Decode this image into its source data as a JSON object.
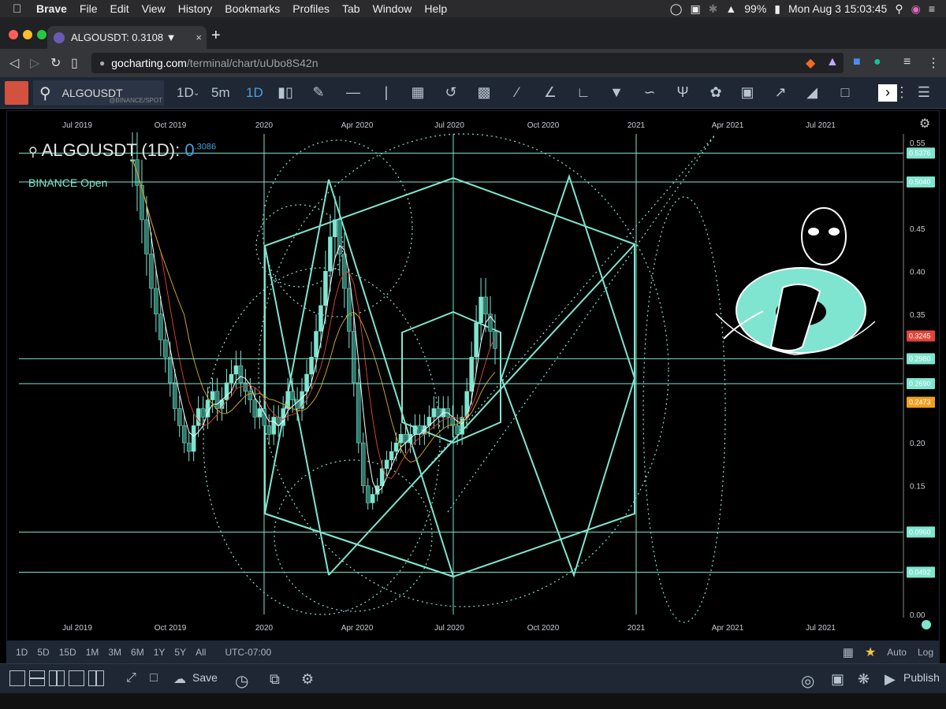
{
  "menubar": {
    "apple": "",
    "app": "Brave",
    "items": [
      "File",
      "Edit",
      "View",
      "History",
      "Bookmarks",
      "Profiles",
      "Tab",
      "Window",
      "Help"
    ],
    "battery": "99%",
    "datetime": "Mon Aug 3  15:03:45"
  },
  "browser": {
    "tab_title": "ALGOUSDT: 0.3108 ▼",
    "tab_close": "×",
    "new_tab": "+",
    "url_host": "gocharting.com",
    "url_path": "/terminal/chart/uUbo8S42n"
  },
  "toolbar": {
    "symbol": "ALGOUSDT",
    "exchange": "@BINANCE/SPOT",
    "interval_dropdown": "1D",
    "interval_5m": "5m",
    "interval_1d": "1D"
  },
  "chart": {
    "legend_symbol": "ALGOUSDT (1D):",
    "legend_value": "0",
    "legend_sup": ".3086",
    "legend_sub": "BINANCE Open",
    "accent": "#7fe5d0"
  },
  "chart_data": {
    "type": "candlestick",
    "title": "ALGOUSDT (1D)",
    "x_tick_labels": [
      "Jul 2019",
      "Oct 2019",
      "2020",
      "Apr 2020",
      "Jul 2020",
      "Oct 2020",
      "2021",
      "Apr 2021",
      "Jul 2021"
    ],
    "y_tick_labels": [
      "0.55",
      "0.45",
      "0.40",
      "0.35",
      "0.20",
      "0.15",
      "0.00"
    ],
    "ylim": [
      0,
      0.56
    ],
    "price_tags": [
      {
        "value": "0.5376",
        "color": "#7fe5d0"
      },
      {
        "value": "0.5040",
        "color": "#7fe5d0"
      },
      {
        "value": "0.3245",
        "color": "#e0463a"
      },
      {
        "value": "0.2980",
        "color": "#7fe5d0"
      },
      {
        "value": "0.2690",
        "color": "#7fe5d0"
      },
      {
        "value": "0.2473",
        "color": "#f0a020"
      },
      {
        "value": "0.0960",
        "color": "#7fe5d0"
      },
      {
        "value": "0.0492",
        "color": "#7fe5d0"
      }
    ],
    "horizontal_levels": [
      0.5376,
      0.504,
      0.298,
      0.269,
      0.096,
      0.0492
    ],
    "close_series": [
      0.53,
      0.5,
      0.46,
      0.42,
      0.38,
      0.35,
      0.32,
      0.3,
      0.27,
      0.24,
      0.22,
      0.2,
      0.19,
      0.22,
      0.24,
      0.23,
      0.25,
      0.26,
      0.24,
      0.25,
      0.27,
      0.28,
      0.29,
      0.27,
      0.26,
      0.25,
      0.23,
      0.24,
      0.22,
      0.21,
      0.23,
      0.22,
      0.24,
      0.26,
      0.25,
      0.24,
      0.26,
      0.28,
      0.3,
      0.33,
      0.36,
      0.4,
      0.44,
      0.46,
      0.42,
      0.38,
      0.33,
      0.27,
      0.2,
      0.15,
      0.13,
      0.14,
      0.15,
      0.17,
      0.18,
      0.19,
      0.2,
      0.21,
      0.2,
      0.21,
      0.22,
      0.21,
      0.22,
      0.23,
      0.24,
      0.23,
      0.24,
      0.23,
      0.22,
      0.21,
      0.23,
      0.26,
      0.3,
      0.34,
      0.37,
      0.35,
      0.33,
      0.31
    ]
  },
  "rangebar": {
    "ranges": [
      "1D",
      "5D",
      "15D",
      "1M",
      "3M",
      "6M",
      "1Y",
      "5Y",
      "All"
    ],
    "timezone": "UTC-07:00",
    "auto": "Auto",
    "log": "Log"
  },
  "bottombar": {
    "save": "Save",
    "publish": "Publish"
  }
}
